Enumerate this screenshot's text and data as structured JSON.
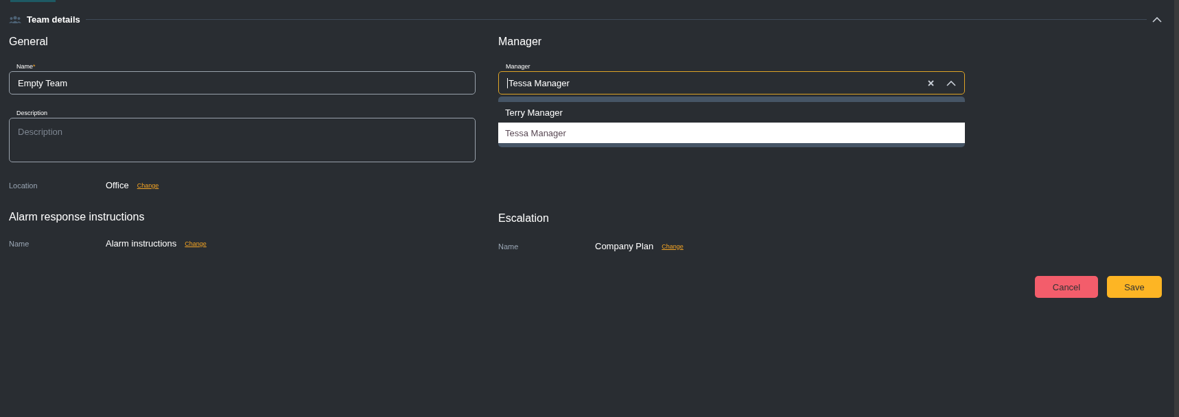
{
  "section": {
    "title": "Team details",
    "expanded": true
  },
  "general": {
    "heading": "General",
    "name_field": {
      "label": "Name",
      "required_mark": "*",
      "value": "Empty Team"
    },
    "description_field": {
      "label": "Description",
      "placeholder": "Description"
    },
    "location": {
      "label": "Location",
      "value": "Office",
      "link": "Change"
    }
  },
  "manager": {
    "heading": "Manager",
    "manager_field": {
      "label": "Manager",
      "value": "Tessa Manager",
      "expanded": true
    },
    "options": [
      {
        "label": "Terry Manager",
        "selected": false
      },
      {
        "label": "Tessa Manager",
        "selected": true
      }
    ]
  },
  "alarm_response": {
    "heading": "Alarm response instructions",
    "label": "Name",
    "value": "Alarm instructions",
    "link": "Change"
  },
  "escalation": {
    "heading": "Escalation",
    "label": "Name",
    "value": "Company Plan",
    "link": "Change"
  },
  "buttons": [
    {
      "label": "Cancel",
      "kind": "danger"
    },
    {
      "label": "Save",
      "kind": "primary"
    }
  ]
}
